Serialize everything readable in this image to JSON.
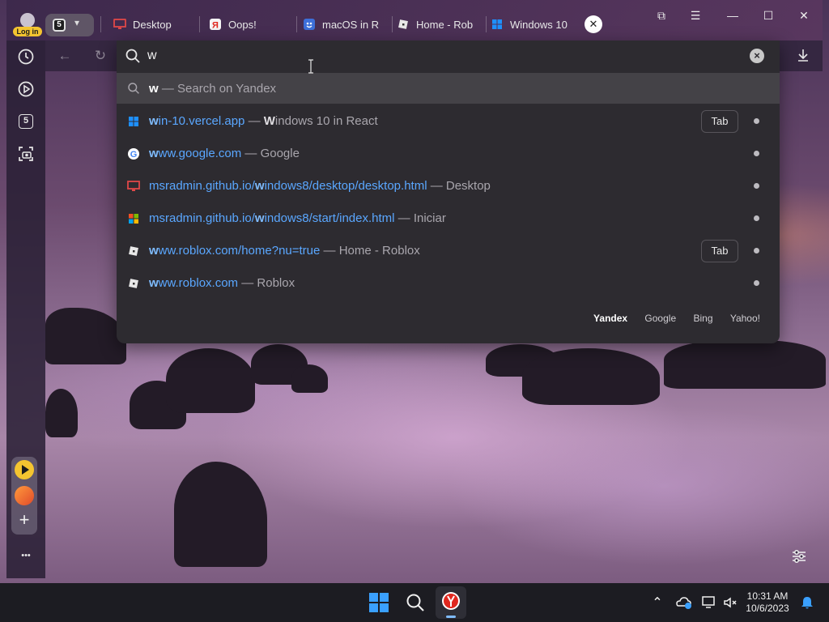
{
  "profile": {
    "login_label": "Log in"
  },
  "tabs_button": {
    "count": "5",
    "chevron": "▾"
  },
  "tabs": [
    {
      "title": "Desktop",
      "icon": "desktop-icon"
    },
    {
      "title": "Oops!",
      "icon": "yandex-icon"
    },
    {
      "title": "macOS in R",
      "icon": "macos-icon"
    },
    {
      "title": "Home - Rob",
      "icon": "roblox-icon"
    },
    {
      "title": "Windows 10",
      "icon": "windows-icon"
    }
  ],
  "tab_close_glyph": "✕",
  "window_controls": {
    "bookmarks": "⧉",
    "menu": "☰",
    "minimize": "—",
    "maximize": "☐",
    "close": "✕"
  },
  "sidebar": {
    "items": [
      {
        "name": "history-icon"
      },
      {
        "name": "video-icon"
      },
      {
        "name": "tab-count-icon",
        "label": "5"
      },
      {
        "name": "screenshot-icon"
      }
    ],
    "more_label": "•••"
  },
  "omnibox": {
    "query": "w",
    "placeholder": "",
    "search_suggestion": {
      "query": "w",
      "suffix": " — Search on Yandex"
    },
    "results": [
      {
        "url_bold": "w",
        "url_rest": "in-10.vercel.app",
        "sep": " — ",
        "title_bold": "W",
        "title_rest": "indows 10 in React",
        "favicon": "windows-icon",
        "tab_label": "Tab"
      },
      {
        "url_bold": "w",
        "url_rest": "ww.google.com",
        "sep": " — ",
        "title_bold": "",
        "title_rest": "Google",
        "favicon": "google-icon",
        "tab_label": ""
      },
      {
        "url_pre": "msradmin.github.io/",
        "url_bold": "w",
        "url_rest": "indows8/desktop/desktop.html",
        "sep": " — ",
        "title_bold": "",
        "title_rest": "Desktop",
        "favicon": "desktop-icon",
        "tab_label": ""
      },
      {
        "url_pre": "msradmin.github.io/",
        "url_bold": "w",
        "url_rest": "indows8/start/index.html",
        "sep": " — ",
        "title_bold": "",
        "title_rest": "Iniciar",
        "favicon": "windows8-icon",
        "tab_label": ""
      },
      {
        "url_bold": "w",
        "url_rest": "ww.roblox.com/home?nu=true",
        "sep": " — ",
        "title_bold": "",
        "title_rest": "Home - Roblox",
        "favicon": "roblox-icon",
        "tab_label": "Tab"
      },
      {
        "url_bold": "w",
        "url_rest": "ww.roblox.com",
        "sep": " — ",
        "title_bold": "",
        "title_rest": "Roblox",
        "favicon": "roblox-icon",
        "tab_label": ""
      }
    ],
    "engines": [
      "Yandex",
      "Google",
      "Bing",
      "Yahoo!"
    ],
    "active_engine": "Yandex"
  },
  "taskbar": {
    "time": "10:31 AM",
    "date": "10/6/2023",
    "tray_up": "⌃"
  },
  "colors": {
    "accent_link": "#5aa7ff",
    "login_badge": "#f4c430",
    "taskbar": "#1c1c22"
  }
}
